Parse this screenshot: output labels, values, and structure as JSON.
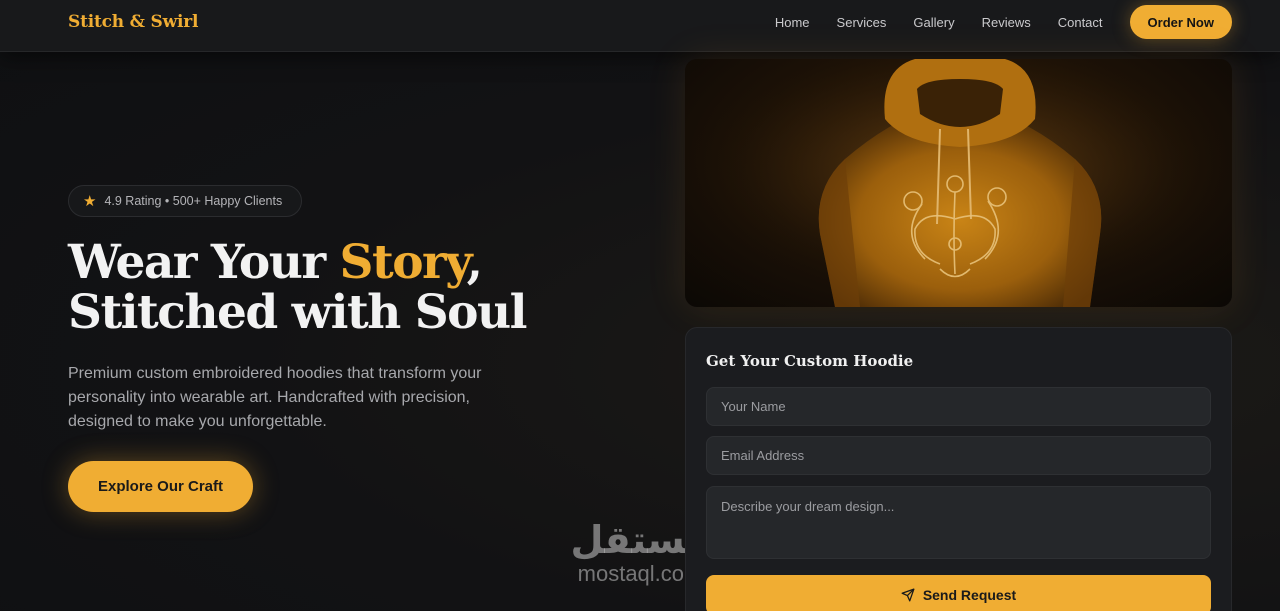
{
  "brand": {
    "name": "Stitch & Swirl"
  },
  "nav": {
    "links": [
      "Home",
      "Services",
      "Gallery",
      "Reviews",
      "Contact"
    ],
    "cta": "Order Now"
  },
  "hero": {
    "badge": {
      "icon": "star-icon",
      "text": "4.9 Rating • 500+ Happy Clients"
    },
    "headline": {
      "part1": "Wear Your ",
      "accent": "Story",
      "part2": ",",
      "line2": "Stitched with Soul"
    },
    "description": "Premium custom embroidered hoodies that transform your personality into wearable art. Handcrafted with precision, designed to make you unforgettable.",
    "cta": "Explore Our Craft"
  },
  "form": {
    "title": "Get Your Custom Hoodie",
    "name_placeholder": "Your Name",
    "email_placeholder": "Email Address",
    "message_placeholder": "Describe your dream design...",
    "submit": "Send Request",
    "submit_icon": "send-icon"
  },
  "watermark": {
    "arabic": "مستقل",
    "latin": "mostaql.com"
  },
  "colors": {
    "accent": "#f0ad33",
    "background": "#121214",
    "surface": "#1b1c1f",
    "input": "#25272a",
    "text": "#f2f2f2",
    "muted": "#a7a8ac"
  }
}
